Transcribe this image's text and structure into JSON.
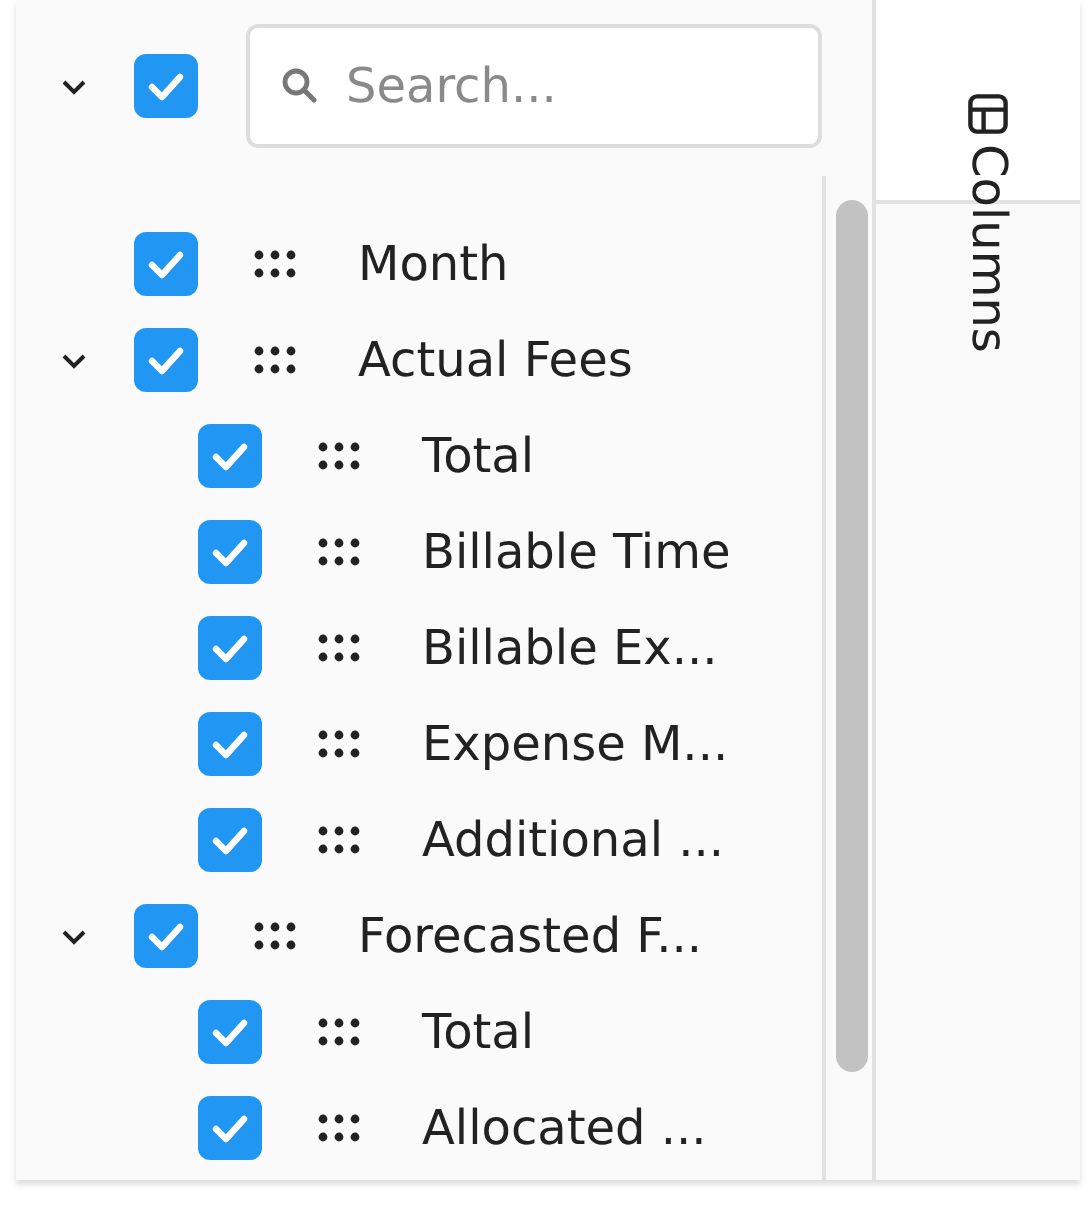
{
  "header": {
    "expanded": true,
    "checked": true
  },
  "search": {
    "placeholder": "Search..."
  },
  "columns": [
    {
      "label": "Month",
      "checked": true
    },
    {
      "label": "Actual Fees",
      "checked": true,
      "expanded": true,
      "children": [
        {
          "label": "Total",
          "checked": true
        },
        {
          "label": "Billable Time",
          "checked": true
        },
        {
          "label": "Billable Ex...",
          "checked": true
        },
        {
          "label": "Expense M...",
          "checked": true
        },
        {
          "label": "Additional ...",
          "checked": true
        }
      ]
    },
    {
      "label": "Forecasted F...",
      "checked": true,
      "expanded": true,
      "children": [
        {
          "label": "Total",
          "checked": true
        },
        {
          "label": "Allocated ...",
          "checked": true
        }
      ]
    }
  ],
  "side_tab": {
    "label": "Columns"
  }
}
